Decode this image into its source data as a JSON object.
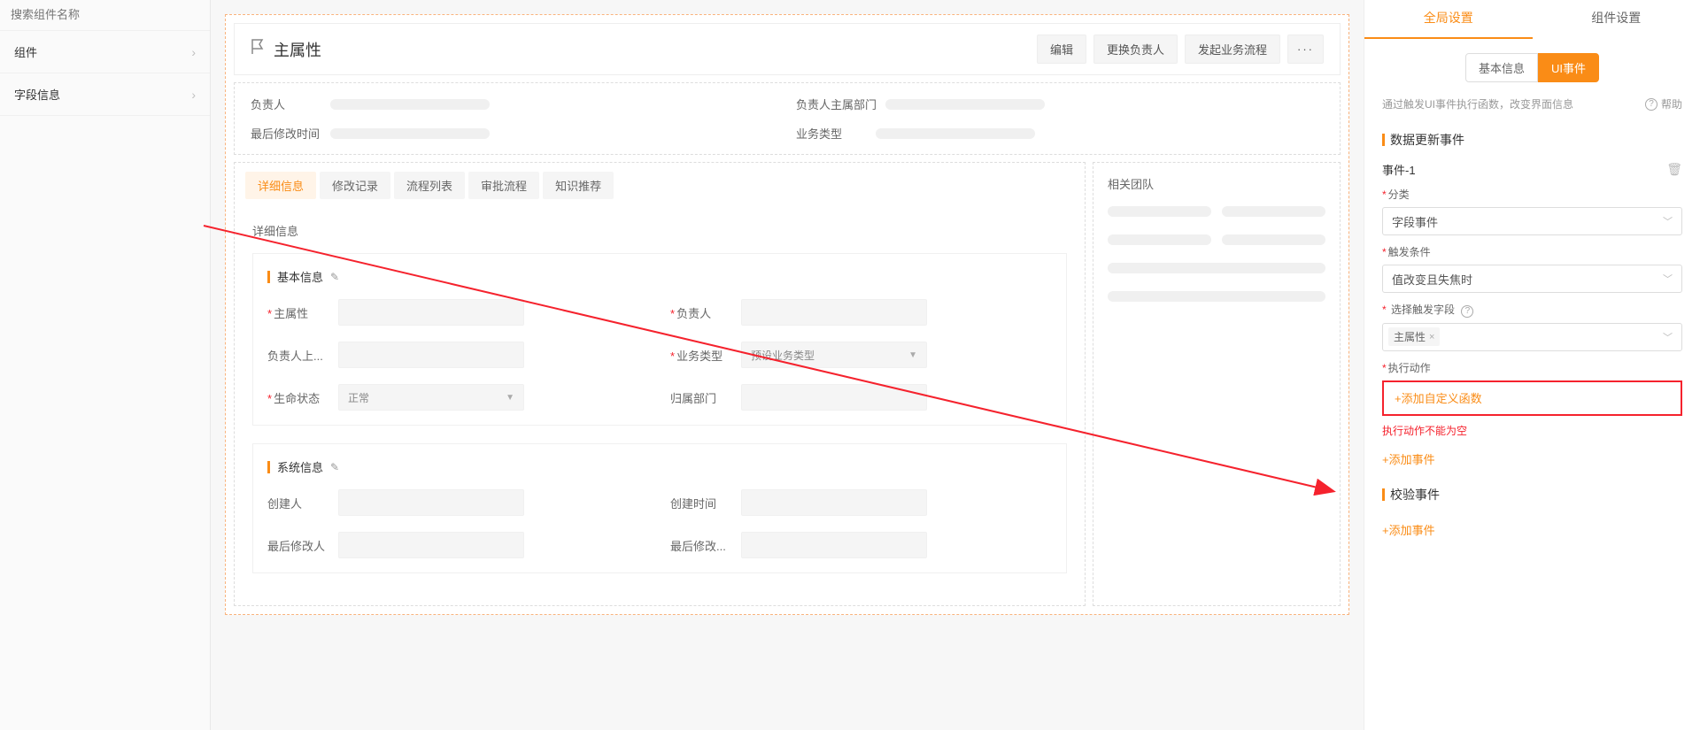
{
  "sidebar": {
    "search_placeholder": "搜索组件名称",
    "items": [
      {
        "label": "组件"
      },
      {
        "label": "字段信息"
      }
    ]
  },
  "header": {
    "title": "主属性",
    "actions": {
      "edit": "编辑",
      "change_owner": "更换负责人",
      "start_flow": "发起业务流程",
      "more": "···"
    }
  },
  "info": {
    "owner": "负责人",
    "owner_dept": "负责人主属部门",
    "last_modified": "最后修改时间",
    "biz_type": "业务类型"
  },
  "tabs": {
    "items": [
      "详细信息",
      "修改记录",
      "流程列表",
      "审批流程",
      "知识推荐"
    ],
    "active": 0,
    "body_title": "详细信息"
  },
  "section_basic": {
    "title": "基本信息",
    "fields": {
      "main_attr": "主属性",
      "owner": "负责人",
      "owner_sup": "负责人上...",
      "biz_type": "业务类型",
      "biz_type_ph": "预设业务类型",
      "life_status": "生命状态",
      "life_status_val": "正常",
      "dept": "归属部门"
    }
  },
  "section_sys": {
    "title": "系统信息",
    "fields": {
      "creator": "创建人",
      "create_time": "创建时间",
      "last_modifier": "最后修改人",
      "last_modify": "最后修改..."
    }
  },
  "related_team": {
    "title": "相关团队"
  },
  "right_panel": {
    "tabs": {
      "global": "全局设置",
      "component": "组件设置",
      "active": 0
    },
    "segments": {
      "basic": "基本信息",
      "ui_event": "UI事件",
      "active": 1
    },
    "help_text": "通过触发UI事件执行函数，改变界面信息",
    "help_link": "帮助",
    "sec_data_update": "数据更新事件",
    "event_name": "事件-1",
    "category_label": "分类",
    "category_value": "字段事件",
    "trigger_label": "触发条件",
    "trigger_value": "值改变且失焦时",
    "select_field_label": "选择触发字段",
    "select_field_tag": "主属性",
    "exec_action_label": "执行动作",
    "add_custom_func": "+添加自定义函数",
    "error_msg": "执行动作不能为空",
    "add_event": "+添加事件",
    "sec_validate": "校验事件"
  }
}
